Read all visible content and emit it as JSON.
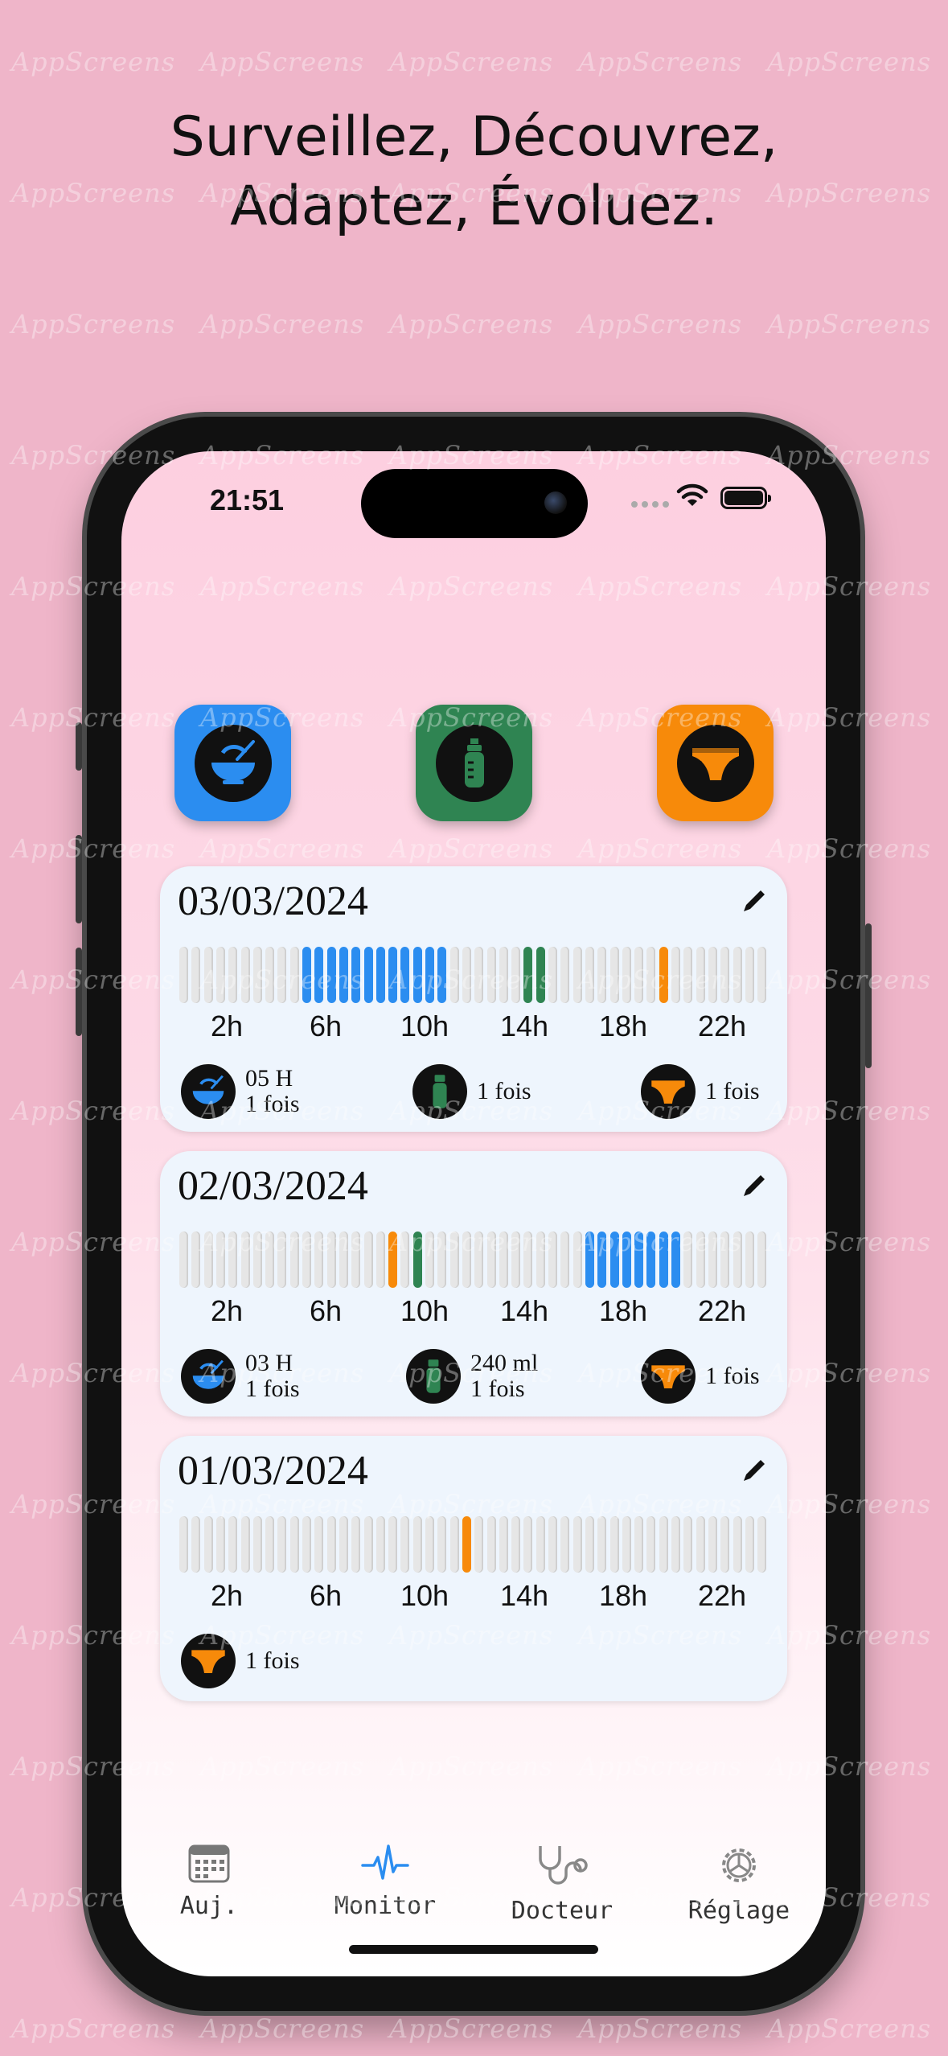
{
  "promo": {
    "headline_line1": "Surveillez, Découvrez,",
    "headline_line2": "Adaptez, Évoluez.",
    "watermark": "AppScreens"
  },
  "status_bar": {
    "time": "21:51"
  },
  "quick_actions": [
    {
      "name": "feeding",
      "icon": "bowl-icon",
      "color": "#2b8df0"
    },
    {
      "name": "bottle",
      "icon": "baby-bottle-icon",
      "color": "#2f8452"
    },
    {
      "name": "diaper",
      "icon": "diaper-icon",
      "color": "#f78a0a"
    }
  ],
  "colors": {
    "feeding": "#2b8df0",
    "bottle": "#2f8452",
    "diaper": "#f78a0a",
    "empty": "#e6e6e6",
    "card": "#eef5fd"
  },
  "hour_labels": [
    "2h",
    "6h",
    "10h",
    "14h",
    "18h",
    "22h"
  ],
  "days": [
    {
      "date": "03/03/2024",
      "timeline": {
        "feeding": [
          10,
          11,
          12,
          13,
          14,
          15,
          16,
          17,
          18,
          19,
          20,
          21
        ],
        "bottle": [
          28,
          29
        ],
        "diaper": [
          39
        ]
      },
      "summary": [
        {
          "type": "feeding",
          "icon": "bowl-icon",
          "line1": "05 H",
          "line2": "1 fois"
        },
        {
          "type": "bottle",
          "icon": "baby-bottle-icon",
          "line1": "",
          "line2": "1 fois"
        },
        {
          "type": "diaper",
          "icon": "diaper-icon",
          "line1": "",
          "line2": "1 fois"
        }
      ]
    },
    {
      "date": "02/03/2024",
      "timeline": {
        "feeding": [
          33,
          34,
          35,
          36,
          37,
          38,
          39,
          40
        ],
        "bottle": [
          19
        ],
        "diaper": [
          17
        ]
      },
      "summary": [
        {
          "type": "feeding",
          "icon": "bowl-icon",
          "line1": "03 H",
          "line2": "1 fois"
        },
        {
          "type": "bottle",
          "icon": "baby-bottle-icon",
          "line1": "240 ml",
          "line2": "1 fois"
        },
        {
          "type": "diaper",
          "icon": "diaper-icon",
          "line1": "",
          "line2": "1 fois"
        }
      ]
    },
    {
      "date": "01/03/2024",
      "timeline": {
        "feeding": [],
        "bottle": [],
        "diaper": [
          23
        ]
      },
      "summary": [
        {
          "type": "diaper",
          "icon": "diaper-icon",
          "line1": "",
          "line2": "1 fois"
        }
      ]
    }
  ],
  "tabs": [
    {
      "label": "Auj.",
      "icon": "calendar-icon",
      "active": false
    },
    {
      "label": "Monitor",
      "icon": "heartbeat-icon",
      "active": true
    },
    {
      "label": "Docteur",
      "icon": "stethoscope-icon",
      "active": false
    },
    {
      "label": "Réglage",
      "icon": "settings-icon",
      "active": false
    }
  ]
}
